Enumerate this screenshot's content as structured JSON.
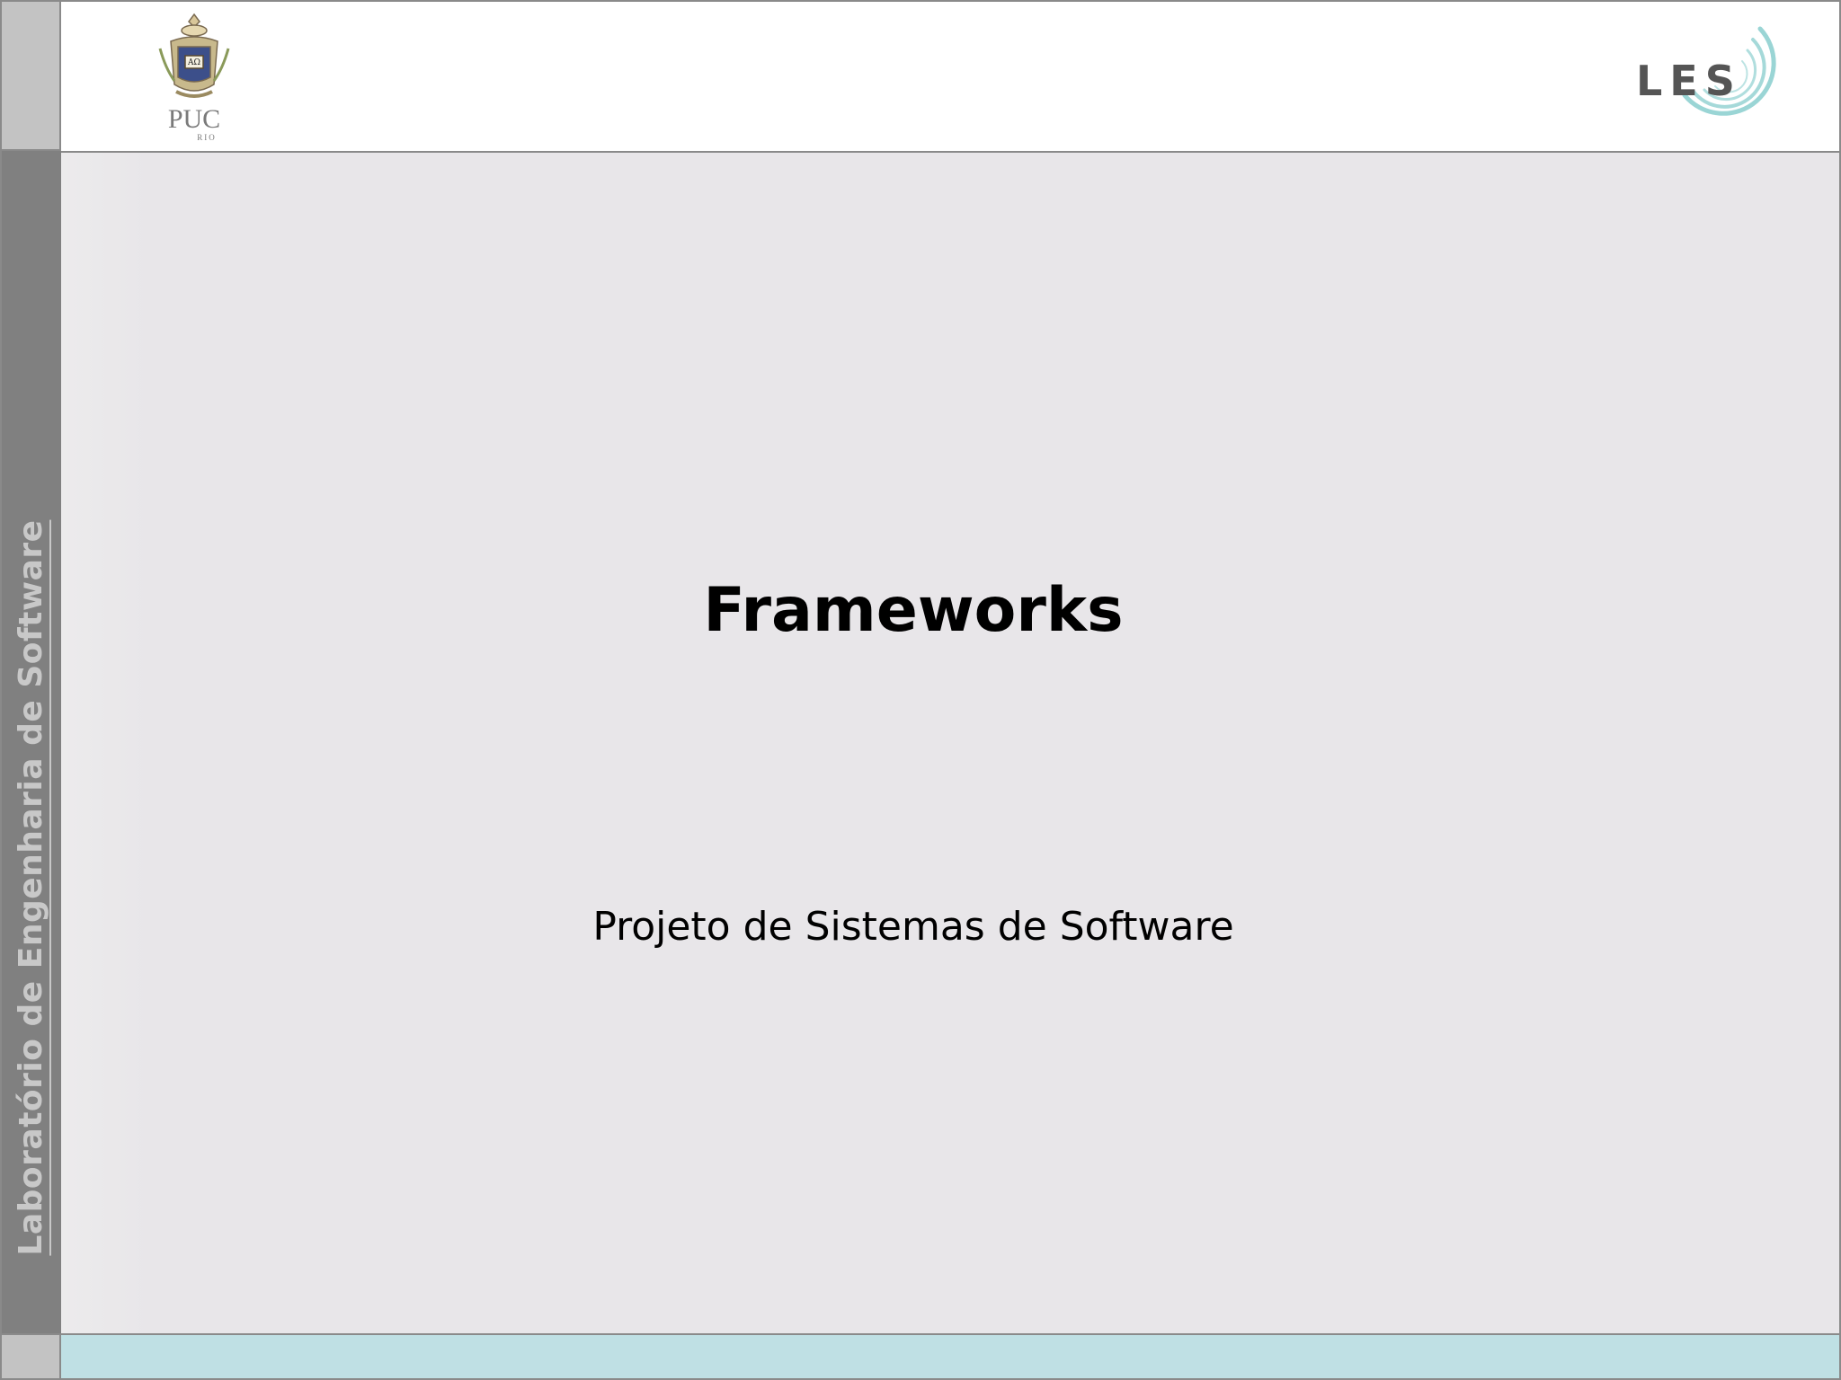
{
  "sidebar": {
    "vertical_label": "Laboratório de Engenharia de Software"
  },
  "header": {
    "left_logo": {
      "name": "puc-rio-logo",
      "text": "PUC",
      "subtext": "RIO"
    },
    "right_logo": {
      "name": "les-logo",
      "text": "LES"
    }
  },
  "slide": {
    "title": "Frameworks",
    "subtitle": "Projeto de Sistemas de Software"
  },
  "colors": {
    "sidebar": "#808080",
    "content_bg": "#e8e6e9",
    "footer_bar": "#bfe0e4",
    "les_accent": "#7fc6c8"
  }
}
